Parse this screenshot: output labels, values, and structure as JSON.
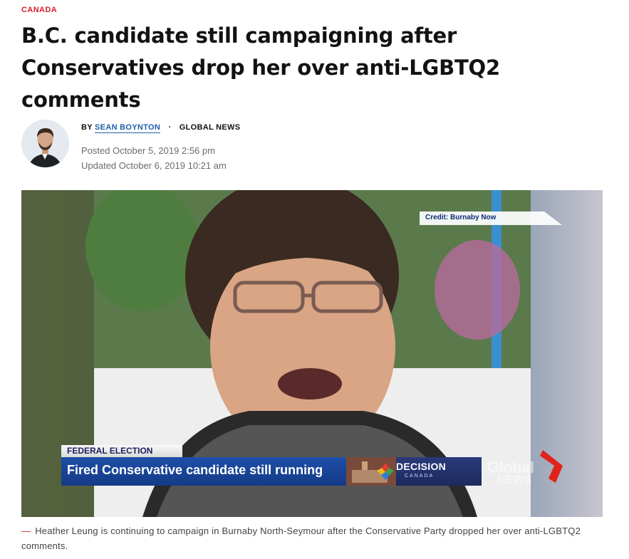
{
  "article": {
    "category": "CANADA",
    "headline": "B.C. candidate still campaigning after Conservatives drop her over anti-LGBTQ2 comments",
    "byline": {
      "by_label": "BY",
      "author": "SEAN BOYNTON",
      "separator": "·",
      "outlet": "GLOBAL NEWS",
      "posted": "Posted October 5, 2019 2:56 pm",
      "updated": "Updated October 6, 2019 10:21 am"
    }
  },
  "video": {
    "credit": "Credit: Burnaby Now",
    "lower_third": {
      "tag": "FEDERAL ELECTION",
      "headline": "Fired Conservative candidate still running",
      "brand_title": "DECISION",
      "brand_subtitle": "CANADA"
    },
    "watermark_top": "Global",
    "watermark_bottom": "NEWS",
    "caption_dash": "—",
    "caption": "Heather Leung is continuing to campaign in Burnaby North-Seymour after the Conservative Party dropped her over anti-LGBTQ2 comments."
  },
  "colors": {
    "accent_red": "#d6202c",
    "link_blue": "#1f5fa8",
    "broadcast_blue": "#1f4fa8"
  }
}
